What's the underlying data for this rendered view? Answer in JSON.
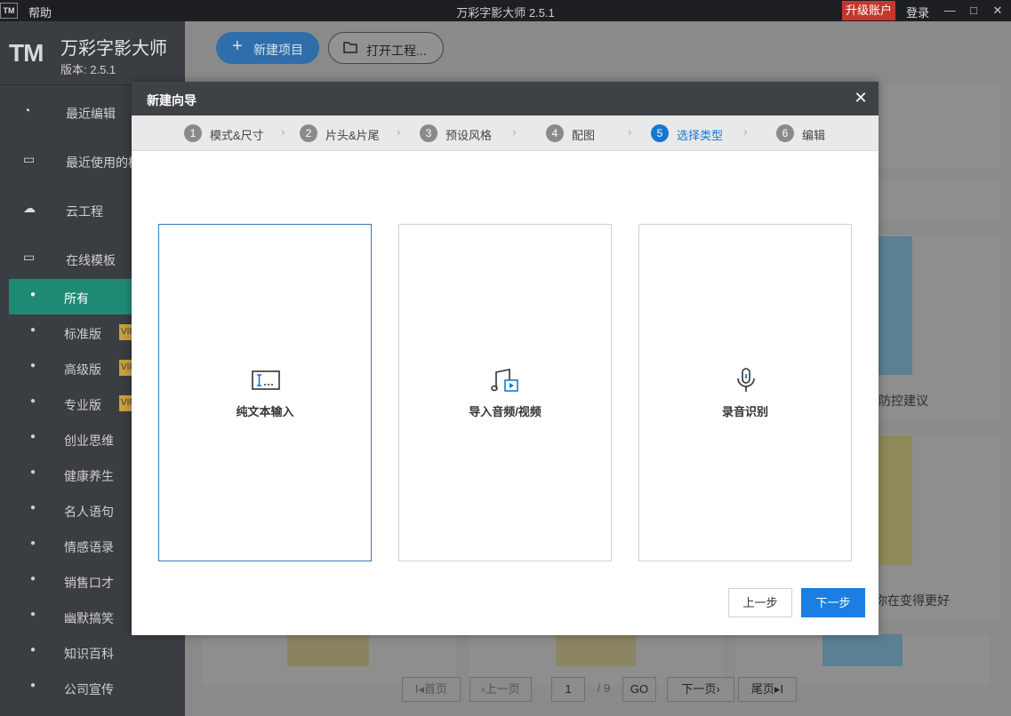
{
  "titlebar": {
    "logo": "TM",
    "help": "帮助",
    "title": "万彩字影大师 2.5.1",
    "upgrade": "升级账户",
    "login": "登录",
    "minimize": "—",
    "maximize": "□",
    "close": "✕"
  },
  "sidebar": {
    "logo": "TM",
    "app_name": "万彩字影大师",
    "version": "版本: 2.5.1",
    "nav": [
      {
        "label": "最近编辑",
        "icon": "◔"
      },
      {
        "label": "最近使用的模",
        "icon": "▭"
      },
      {
        "label": "云工程",
        "icon": "☁"
      },
      {
        "label": "在线模板",
        "icon": "▭"
      }
    ],
    "categories": [
      {
        "label": "所有",
        "vip": ""
      },
      {
        "label": "标准版",
        "vip": "VIP"
      },
      {
        "label": "高级版",
        "vip": "VIP"
      },
      {
        "label": "专业版",
        "vip": "VIP"
      },
      {
        "label": "创业思维",
        "vip": ""
      },
      {
        "label": "健康养生",
        "vip": ""
      },
      {
        "label": "名人语句",
        "vip": ""
      },
      {
        "label": "情感语录",
        "vip": ""
      },
      {
        "label": "销售口才",
        "vip": ""
      },
      {
        "label": "幽默搞笑",
        "vip": ""
      },
      {
        "label": "知识百科",
        "vip": ""
      },
      {
        "label": "公司宣传",
        "vip": ""
      }
    ],
    "bullet": "●"
  },
  "main": {
    "new_project": "新建项目",
    "new_project_icon": "+",
    "open_project": "打开工程...",
    "bg_texts": [
      "防控建议",
      "你在变得更好"
    ],
    "pagination": {
      "first": "I◂首页",
      "prev": "‹上一页",
      "page_input": "1",
      "total": "/ 9",
      "go": "GO",
      "next": "下一页›",
      "last": "尾页▸I"
    }
  },
  "dialog": {
    "title": "新建向导",
    "close": "✕",
    "steps": [
      {
        "num": "1",
        "label": "模式&尺寸"
      },
      {
        "num": "2",
        "label": "片头&片尾"
      },
      {
        "num": "3",
        "label": "预设风格"
      },
      {
        "num": "4",
        "label": "配图"
      },
      {
        "num": "5",
        "label": "选择类型"
      },
      {
        "num": "6",
        "label": "编辑"
      }
    ],
    "active_step": 5,
    "chevron": "›",
    "options": [
      {
        "label": "纯文本输入",
        "icon": "text-input-icon",
        "selected": true
      },
      {
        "label": "导入音频/视频",
        "icon": "audio-video-icon",
        "selected": false
      },
      {
        "label": "录音识别",
        "icon": "microphone-icon",
        "selected": false
      }
    ],
    "prev_button": "上一步",
    "next_button": "下一步"
  },
  "colors": {
    "accent": "#1677d2",
    "next_button": "#1a7fe0",
    "sidebar_active": "#1f8a73",
    "upgrade": "#c0392b"
  }
}
